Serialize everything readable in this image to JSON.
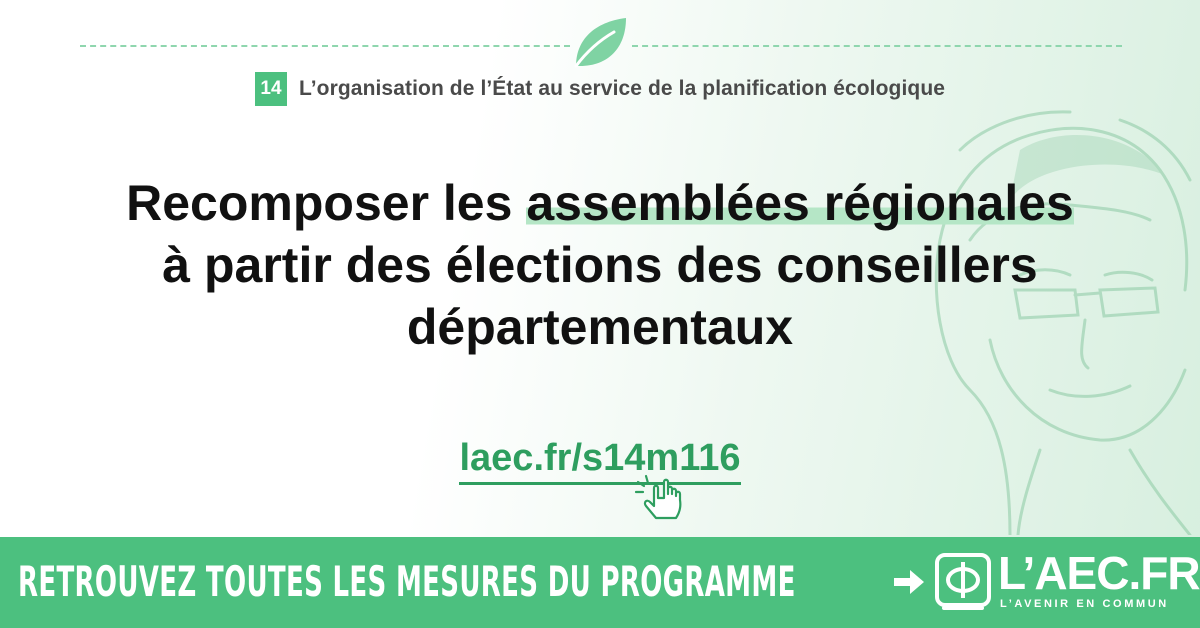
{
  "section": {
    "number": "14",
    "title": "L’organisation de l’État au service de la planification écologique"
  },
  "headline": {
    "part1": "Recomposer les ",
    "highlight": "assemblées régionales",
    "line2": "à partir des élections des conseillers",
    "line3": "départementaux"
  },
  "link": {
    "text": "laec.fr/s14m116"
  },
  "banner": {
    "text": "RETROUVEZ TOUTES LES MESURES DU PROGRAMME",
    "logo_name": "L’AEC.FR",
    "logo_tagline": "L’AVENIR EN COMMUN"
  },
  "colors": {
    "accent": "#4cc07f",
    "link": "#2e9e5f",
    "highlight": "#b5e6c6",
    "dash": "#8fd6ae",
    "text": "#111111"
  },
  "icons": [
    "leaf-icon",
    "pointer-hand-icon",
    "arrow-right-icon",
    "phi-logo-icon"
  ]
}
